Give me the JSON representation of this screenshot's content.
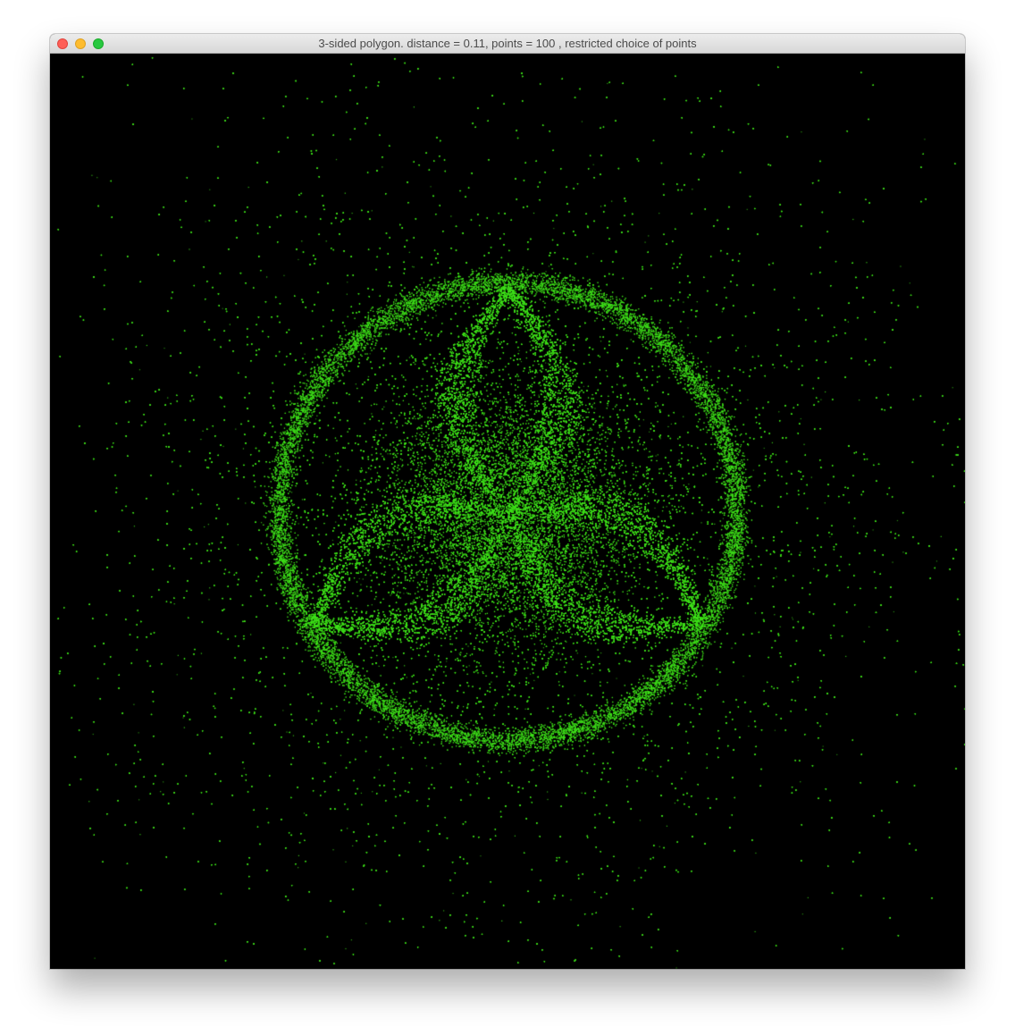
{
  "window": {
    "title": "3-sided polygon. distance = 0.11, points = 100 , restricted choice of points",
    "controls": [
      "close",
      "minimize",
      "zoom"
    ],
    "control_colors": {
      "close": "#fe5f57",
      "minimize": "#febc2e",
      "zoom": "#28c840"
    }
  },
  "plot": {
    "background": "#000000",
    "point_color": "#3ee01a",
    "polygon_sides": 3,
    "distance": 0.11,
    "points": 100,
    "rule": "restricted choice of points"
  }
}
